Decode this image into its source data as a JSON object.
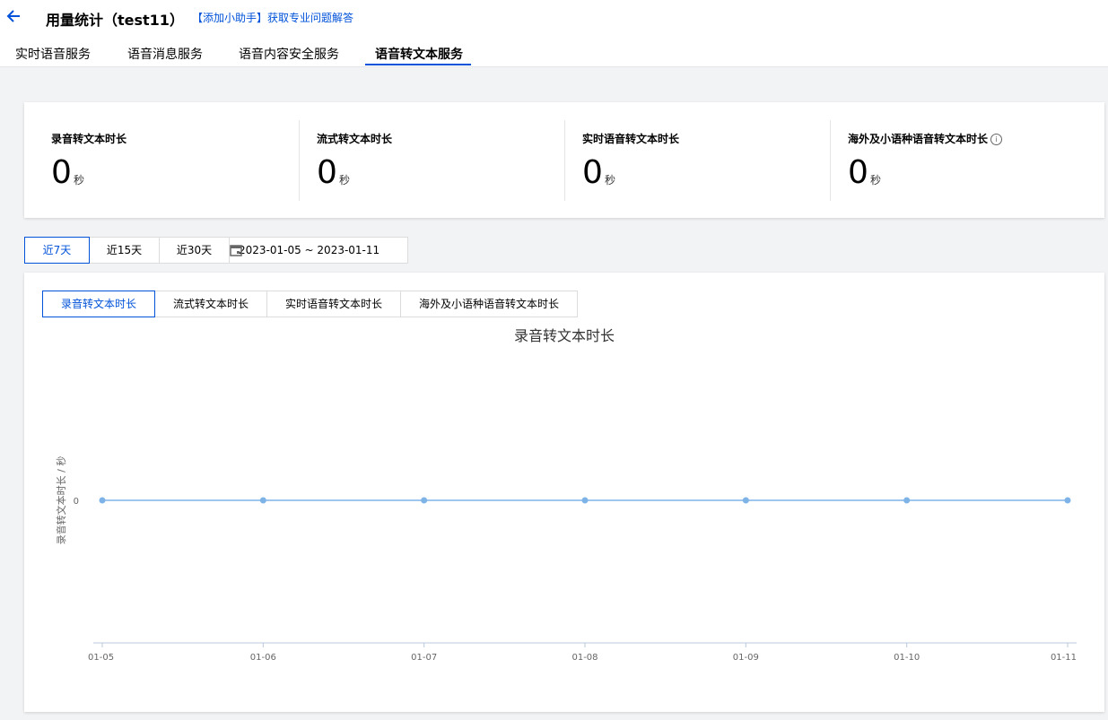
{
  "header": {
    "title": "用量统计（test11）",
    "helper_link": "【添加小助手】获取专业问题解答"
  },
  "tabs": [
    {
      "label": "实时语音服务"
    },
    {
      "label": "语音消息服务"
    },
    {
      "label": "语音内容安全服务"
    },
    {
      "label": "语音转文本服务"
    }
  ],
  "stats": [
    {
      "label": "录音转文本时长",
      "value": "0",
      "unit": "秒"
    },
    {
      "label": "流式转文本时长",
      "value": "0",
      "unit": "秒"
    },
    {
      "label": "实时语音转文本时长",
      "value": "0",
      "unit": "秒"
    },
    {
      "label": "海外及小语种语音转文本时长",
      "value": "0",
      "unit": "秒"
    }
  ],
  "range_buttons": [
    {
      "label": "近7天"
    },
    {
      "label": "近15天"
    },
    {
      "label": "近30天"
    }
  ],
  "date_range": "2023-01-05 ~ 2023-01-11",
  "subtabs": [
    {
      "label": "录音转文本时长"
    },
    {
      "label": "流式转文本时长"
    },
    {
      "label": "实时语音转文本时长"
    },
    {
      "label": "海外及小语种语音转文本时长"
    }
  ],
  "colors": {
    "accent": "#0052d9",
    "series": "#7eb3e8"
  },
  "chart_data": {
    "type": "line",
    "title": "录音转文本时长",
    "ylabel": "录音转文本时长 / 秒",
    "xlabel": "",
    "categories": [
      "01-05",
      "01-06",
      "01-07",
      "01-08",
      "01-09",
      "01-10",
      "01-11"
    ],
    "yticks": [
      "0"
    ],
    "series": [
      {
        "values": [
          0,
          0,
          0,
          0,
          0,
          0,
          0
        ]
      }
    ],
    "grid": false,
    "legend": "none"
  }
}
